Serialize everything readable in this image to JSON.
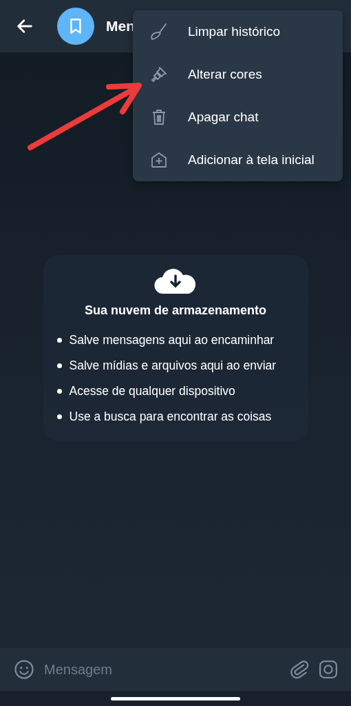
{
  "header": {
    "title": "Men"
  },
  "menu": {
    "items": [
      {
        "kind": "broom",
        "label": "Limpar histórico"
      },
      {
        "kind": "brush",
        "label": "Alterar cores"
      },
      {
        "kind": "trash",
        "label": "Apagar chat"
      },
      {
        "kind": "home-add",
        "label": "Adicionar à tela inicial"
      }
    ]
  },
  "empty_state": {
    "title": "Sua nuvem de armazenamento",
    "bullets": [
      "Salve mensagens aqui ao encaminhar",
      "Salve mídias e arquivos aqui ao enviar",
      "Acesse de qualquer dispositivo",
      "Use a busca para encontrar as coisas"
    ]
  },
  "composer": {
    "placeholder": "Mensagem"
  }
}
